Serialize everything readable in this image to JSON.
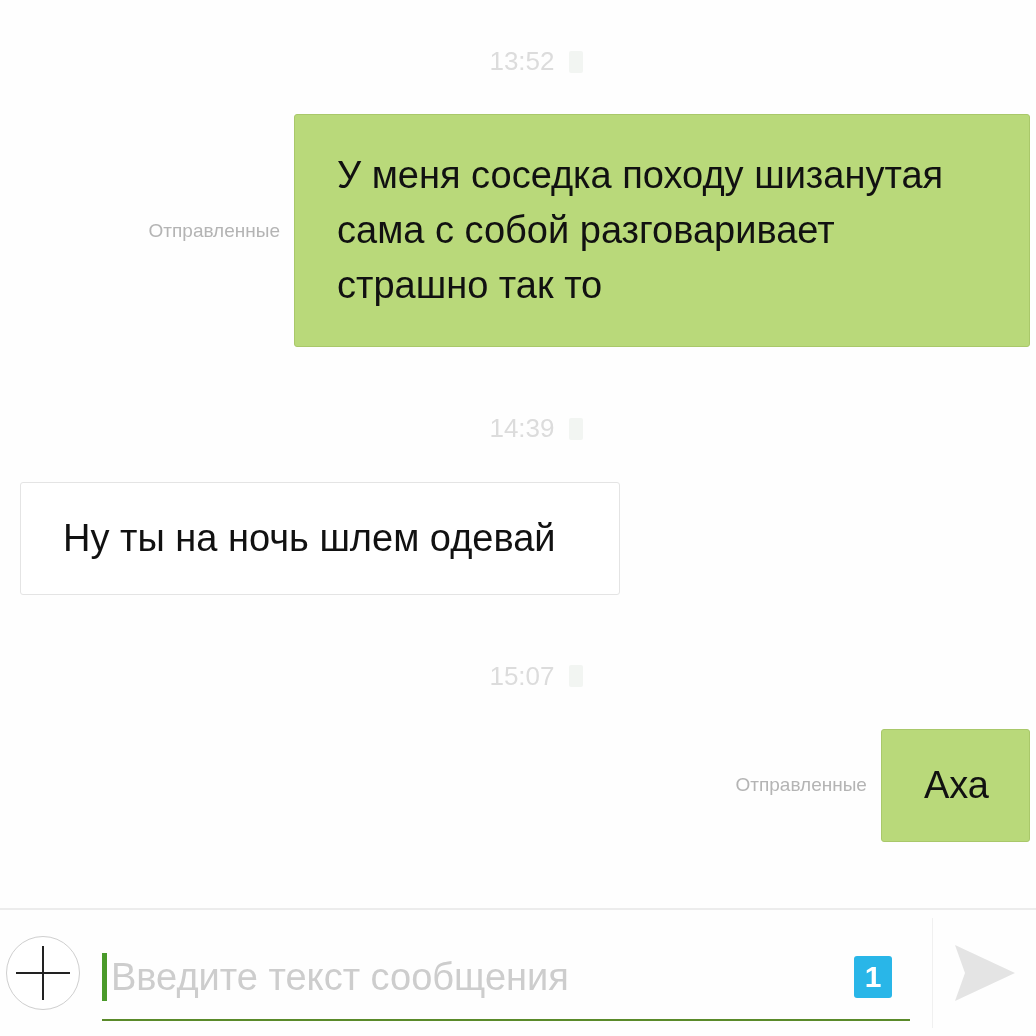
{
  "messages": [
    {
      "kind": "time",
      "text": "13:52"
    },
    {
      "kind": "outgoing",
      "status": "Отправленные",
      "text": "У меня соседка походу шизанутая сама с собой разговаривает страшно так то"
    },
    {
      "kind": "time",
      "text": "14:39"
    },
    {
      "kind": "incoming",
      "text": "Ну ты на ночь шлем одевай"
    },
    {
      "kind": "time",
      "text": "15:07"
    },
    {
      "kind": "outgoing",
      "status": "Отправленные",
      "text": "Аха"
    }
  ],
  "composer": {
    "placeholder": "Введите текст сообщения",
    "sim": "1"
  }
}
